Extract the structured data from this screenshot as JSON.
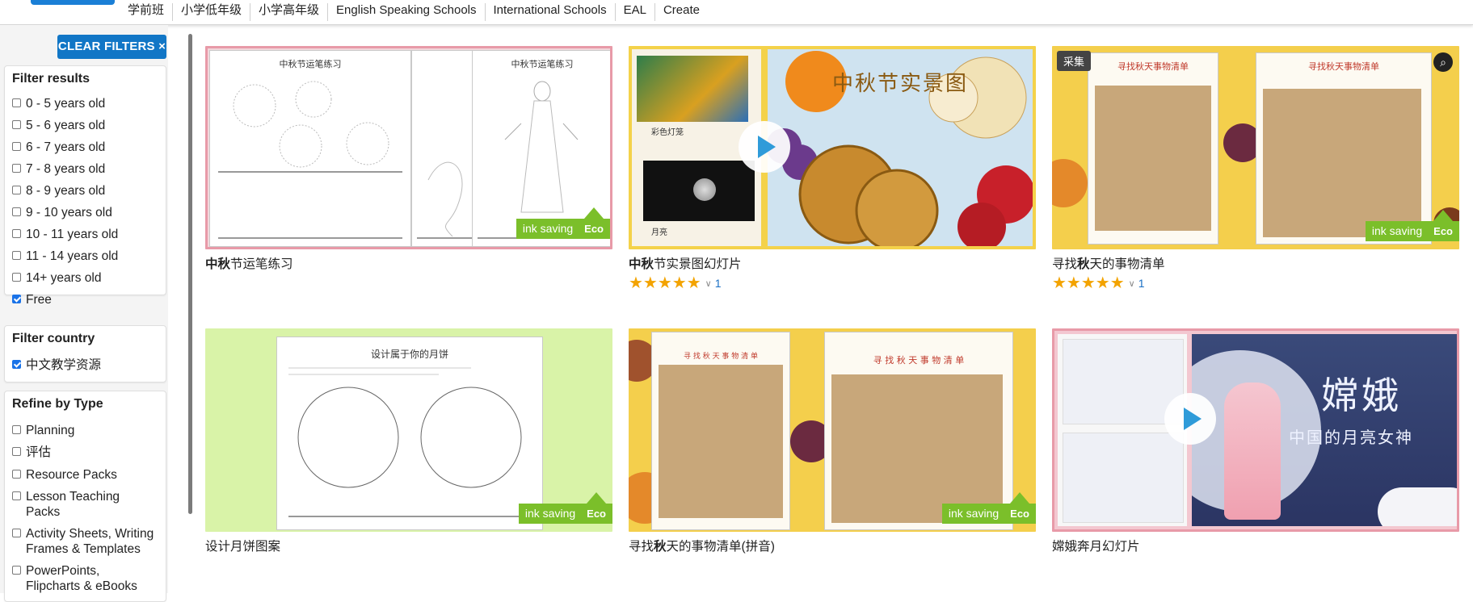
{
  "nav": {
    "links": [
      "学前班",
      "小学低年级",
      "小学高年级",
      "English Speaking Schools",
      "International Schools",
      "EAL",
      "Create"
    ]
  },
  "sidebar": {
    "clear_filters": "CLEAR FILTERS ×",
    "filter_results": {
      "heading": "Filter results",
      "options": [
        {
          "label": "0 - 5 years old",
          "checked": false
        },
        {
          "label": "5 - 6 years old",
          "checked": false
        },
        {
          "label": "6 - 7 years old",
          "checked": false
        },
        {
          "label": "7 - 8 years old",
          "checked": false
        },
        {
          "label": "8 - 9 years old",
          "checked": false
        },
        {
          "label": "9 - 10 years old",
          "checked": false
        },
        {
          "label": "10 - 11 years old",
          "checked": false
        },
        {
          "label": "11 - 14 years old",
          "checked": false
        },
        {
          "label": "14+ years old",
          "checked": false
        },
        {
          "label": "Free",
          "checked": true
        }
      ]
    },
    "filter_country": {
      "heading": "Filter country",
      "options": [
        {
          "label": "中文教学资源",
          "checked": true
        }
      ]
    },
    "refine_type": {
      "heading": "Refine by Type",
      "options": [
        {
          "label": "Planning",
          "checked": false
        },
        {
          "label": "评估",
          "checked": false
        },
        {
          "label": "Resource Packs",
          "checked": false
        },
        {
          "label": "Lesson Teaching Packs",
          "checked": false
        },
        {
          "label": "Activity Sheets, Writing Frames & Templates",
          "checked": false
        },
        {
          "label": "PowerPoints, Flipcharts & eBooks",
          "checked": false
        }
      ]
    }
  },
  "eco": {
    "ink": "ink saving",
    "eco": "Eco"
  },
  "cards": [
    {
      "title_bold": "中秋",
      "title_rest": "节运笔练习",
      "sheet_titles": [
        "中秋节运笔练习",
        "中秋节运笔练习",
        "中秋节运笔练习"
      ]
    },
    {
      "title_bold": "中秋",
      "title_rest": "节实景图幻灯片",
      "stars": "★★★★★",
      "count": "1",
      "slide_title": "中秋节实景图",
      "captions": [
        "彩色灯笼",
        "月亮"
      ]
    },
    {
      "title_bold": "",
      "title_pre": "寻找",
      "title_mid": "秋",
      "title_rest": "天的事物清单",
      "stars": "★★★★★",
      "count": "1",
      "badge": "采集",
      "sheet_titles": [
        "寻找秋天事物清单",
        "寻找秋天事物清单"
      ]
    },
    {
      "title_rest": "设计月饼图案",
      "sheet_titles": [
        "设计属于你的月饼"
      ]
    },
    {
      "title_pre": "寻找",
      "title_mid": "秋",
      "title_rest": "天的事物清单(拼音)",
      "sheet_titles": [
        "寻 找 秋 天 事 物 清 单",
        "寻 找 秋 天 事 物 清 单"
      ]
    },
    {
      "title_rest": "嫦娥奔月幻灯片",
      "slide_title": "嫦娥",
      "slide_sub": "中国的月亮女神"
    }
  ],
  "colors": {
    "accent": "#1176c6",
    "eco": "#7bbf2a",
    "star": "#f3a300",
    "pink_border": "#e89aa8"
  }
}
